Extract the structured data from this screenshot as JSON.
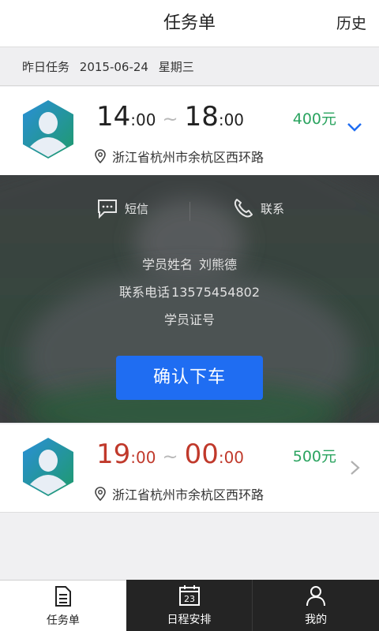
{
  "header": {
    "title": "任务单",
    "history_label": "历史"
  },
  "datebar": {
    "label": "昨日任务",
    "date": "2015-06-24",
    "weekday": "星期三"
  },
  "tasks": [
    {
      "start_hour": "14",
      "start_min": ":00",
      "tilde": "~",
      "end_hour": "18",
      "end_min": ":00",
      "price": "400元",
      "address": "浙江省杭州市余杭区西环路",
      "time_color": "#222222"
    },
    {
      "start_hour": "19",
      "start_min": ":00",
      "tilde": "~",
      "end_hour": "00",
      "end_min": ":00",
      "price": "500元",
      "address": "浙江省杭州市余杭区西环路",
      "time_color": "#c0392b"
    }
  ],
  "detail": {
    "sms_label": "短信",
    "call_label": "联系",
    "student_name_label": "学员姓名",
    "student_name": "刘熊德",
    "phone_label": "联系电话",
    "phone": "13575454802",
    "student_id_label": "学员证号",
    "confirm_label": "确认下车"
  },
  "nav": {
    "tabs": [
      {
        "label": "任务单",
        "icon": "document-icon"
      },
      {
        "label": "日程安排",
        "icon": "calendar-icon",
        "day": "23"
      },
      {
        "label": "我的",
        "icon": "person-icon"
      }
    ]
  },
  "colors": {
    "accent": "#1f6df2",
    "price": "#2aa35f",
    "late_time": "#c0392b"
  }
}
